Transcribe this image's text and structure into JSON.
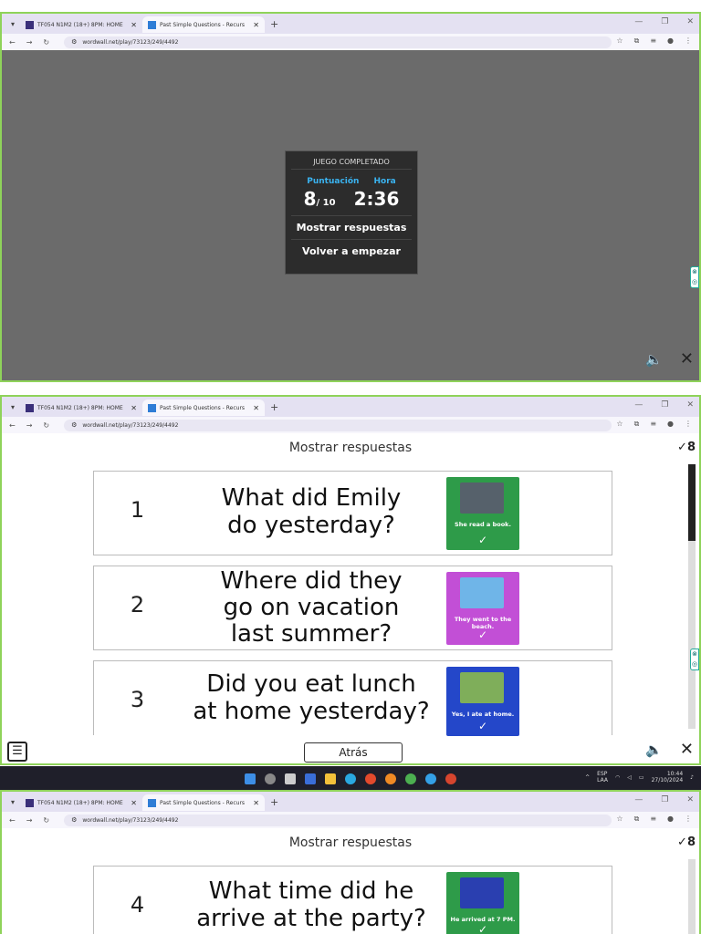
{
  "browser": {
    "tab1_title": "TF054 N1M2 (18+) 8PM: HOME",
    "tab2_title": "Past Simple Questions - Recurs",
    "url": "wordwall.net/play/73123/249/4492"
  },
  "result_card": {
    "title": "JUEGO COMPLETADO",
    "score_label": "Puntuación",
    "time_label": "Hora",
    "score": "8",
    "score_total": "/ 10",
    "time": "2:36",
    "show_answers": "Mostrar respuestas",
    "restart": "Volver a empezar"
  },
  "answers": {
    "title": "Mostrar respuestas",
    "check_count": "8",
    "back": "Atrás",
    "rows": [
      {
        "num": "1",
        "q1": "What did Emily",
        "q2": "do yesterday?",
        "q3": "",
        "caption": "She read a book.",
        "color": "#2e9b49"
      },
      {
        "num": "2",
        "q1": "Where did they",
        "q2": "go on vacation",
        "q3": "last summer?",
        "caption": "They went to the beach.",
        "color": "#c24fd6"
      },
      {
        "num": "3",
        "q1": "Did you eat lunch",
        "q2": "at home yesterday?",
        "q3": "",
        "caption": "Yes, I ate at home.",
        "color": "#2447c9"
      },
      {
        "num": "4",
        "q1": "What time did he",
        "q2": "arrive at the party?",
        "q3": "",
        "caption": "He arrived at 7 PM.",
        "color": "#2e9b49"
      }
    ]
  },
  "taskbar": {
    "lang": "ESP",
    "region": "LAA",
    "time": "10:44",
    "date": "27/10/2024"
  }
}
